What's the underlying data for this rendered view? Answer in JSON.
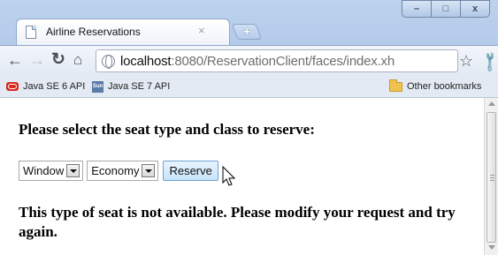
{
  "tab": {
    "title": "Airline Reservations",
    "close_glyph": "×",
    "new_tab_glyph": "+"
  },
  "window_controls": {
    "minimize": "–",
    "maximize": "□",
    "close": "x"
  },
  "toolbar": {
    "url_host": "localhost",
    "url_path": ":8080/ReservationClient/faces/index.xh"
  },
  "bookmarks": {
    "items": [
      {
        "label": "Java SE 6 API",
        "icon": "oracle-icon"
      },
      {
        "label": "Java SE 7 API",
        "icon": "sun-icon"
      }
    ],
    "other": "Other bookmarks"
  },
  "page": {
    "heading": "Please select the seat type and class to reserve:",
    "seat_type_select": {
      "value": "Window"
    },
    "class_select": {
      "value": "Economy"
    },
    "reserve_button": "Reserve",
    "message": "This type of seat is not available. Please modify your request and try again."
  }
}
